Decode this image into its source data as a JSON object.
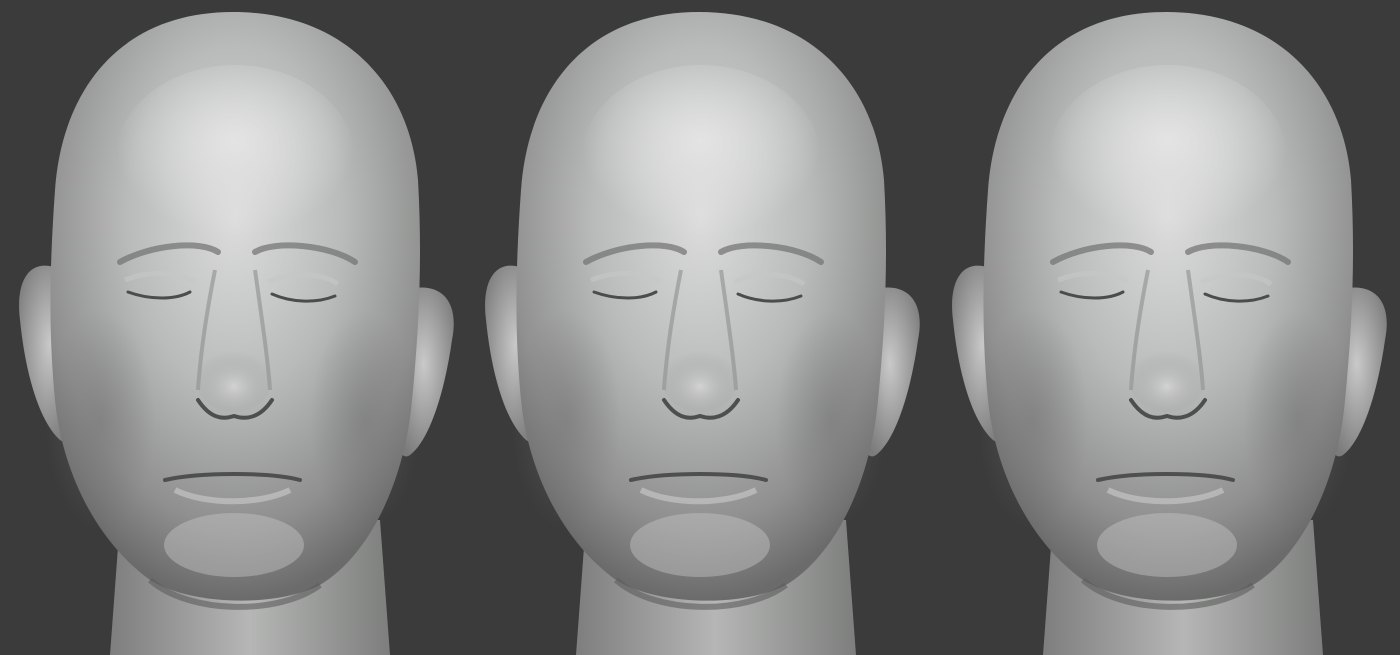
{
  "scene": {
    "background_color": "#3b3b3b",
    "material_color": "#a9aaa9",
    "highlight_color": "#d8d8d8",
    "shadow_color": "#5a5b5a",
    "renders": [
      {
        "name": "head-render-front-1",
        "eyes": "closed"
      },
      {
        "name": "head-render-front-2",
        "eyes": "closed"
      },
      {
        "name": "head-render-front-3",
        "eyes": "closed"
      }
    ]
  }
}
